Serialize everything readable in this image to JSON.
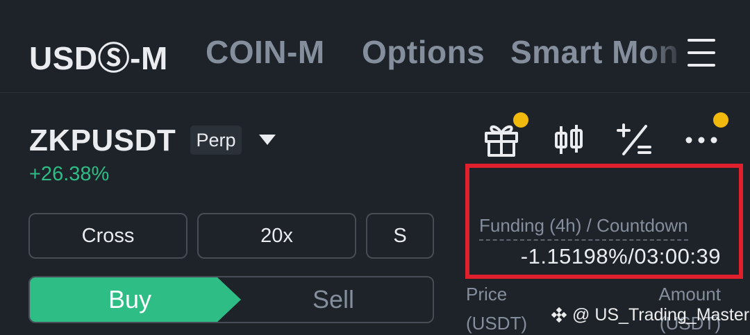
{
  "tabs": [
    {
      "label": "USDⓈ-M",
      "active": true
    },
    {
      "label": "COIN-M",
      "active": false
    },
    {
      "label": "Options",
      "active": false
    },
    {
      "label": "Smart Mon",
      "active": false
    }
  ],
  "symbol": {
    "name": "ZKPUSDT",
    "badge": "Perp",
    "change": "+26.38%"
  },
  "toolbar_icons": [
    "gift-icon",
    "candlestick-chart-icon",
    "calculator-icon",
    "more-icon"
  ],
  "funding": {
    "label": "Funding (4h) / Countdown",
    "value": "-1.15198%/03:00:39"
  },
  "controls": {
    "margin_mode": "Cross",
    "leverage": "20x",
    "third": "S"
  },
  "trade": {
    "buy_label": "Buy",
    "sell_label": "Sell"
  },
  "order_book": {
    "price_header": "Price",
    "price_unit": "(USDT)",
    "amount_header": "Amount",
    "amount_unit": "(USDT)"
  },
  "watermark": "@ US_Trading_Master",
  "colors": {
    "background": "#1e2329",
    "up_green": "#2ebd85",
    "highlight_red": "#e0202c",
    "badge_yellow": "#f0b90b"
  }
}
